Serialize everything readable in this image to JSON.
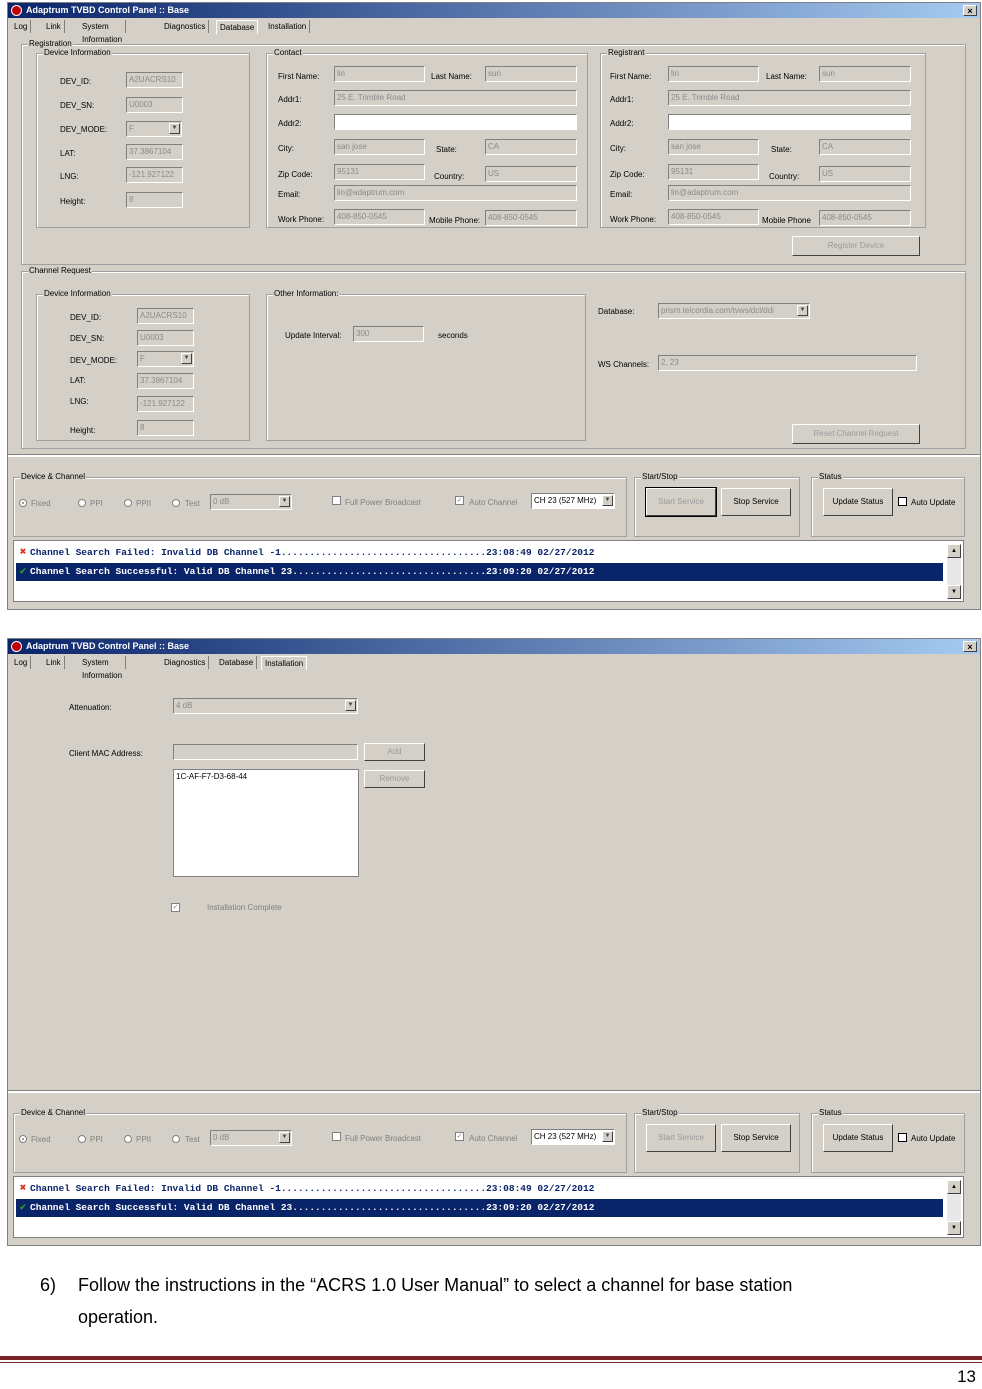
{
  "window1": {
    "title": "Adaptrum TVBD Control Panel :: Base",
    "close_glyph": "×",
    "tabs": [
      "Log",
      "Link",
      "System Information",
      "Diagnostics",
      "Database",
      "Installation"
    ],
    "active_tab": "Database",
    "registration": {
      "label": "Registration",
      "device_info": {
        "label": "Device Information",
        "dev_id_label": "DEV_ID:",
        "dev_id": "A2UACRS10",
        "dev_sn_label": "DEV_SN:",
        "dev_sn": "U0003",
        "dev_mode_label": "DEV_MODE:",
        "dev_mode": "F",
        "lat_label": "LAT:",
        "lat": "37.3867104",
        "lng_label": "LNG:",
        "lng": "-121.927122",
        "height_label": "Height:",
        "height": "8"
      },
      "contact": {
        "label": "Contact",
        "first_name_label": "First Name:",
        "first_name": "lin",
        "last_name_label": "Last Name:",
        "last_name": "sun",
        "addr1_label": "Addr1:",
        "addr1": "25 E. Trimble Road",
        "addr2_label": "Addr2:",
        "addr2": "",
        "city_label": "City:",
        "city": "san jose",
        "state_label": "State:",
        "state": "CA",
        "zip_label": "Zip Code:",
        "zip": "95131",
        "country_label": "Country:",
        "country": "US",
        "email_label": "Email:",
        "email": "lin@adaptrum.com",
        "work_phone_label": "Work Phone:",
        "work_phone": "408-850-0545",
        "mobile_phone_label": "Mobile Phone:",
        "mobile_phone": "408-850-0545"
      },
      "registrant": {
        "label": "Registrant",
        "first_name_label": "First Name:",
        "first_name": "lin",
        "last_name_label": "Last Name:",
        "last_name": "sun",
        "addr1_label": "Addr1:",
        "addr1": "25 E. Trimble Road",
        "addr2_label": "Addr2:",
        "addr2": "",
        "city_label": "City:",
        "city": "san jose",
        "state_label": "State:",
        "state": "CA",
        "zip_label": "Zip Code:",
        "zip": "95131",
        "country_label": "Country:",
        "country": "US",
        "email_label": "Email:",
        "email": "lin@adaptrum.com",
        "work_phone_label": "Work Phone:",
        "work_phone": "408-850-0545",
        "mobile_phone_label": "Mobile Phone",
        "mobile_phone": "408-850-0545"
      },
      "register_button": "Register Device"
    },
    "channel_request": {
      "label": "Channel Request",
      "device_info": {
        "label": "Device Information",
        "dev_id_label": "DEV_ID:",
        "dev_id": "A2UACRS10",
        "dev_sn_label": "DEV_SN:",
        "dev_sn": "U0003",
        "dev_mode_label": "DEV_MODE:",
        "dev_mode": "F",
        "lat_label": "LAT:",
        "lat": "37.3867104",
        "lng_label": "LNG:",
        "lng": "-121.927122",
        "height_label": "Height:",
        "height": "8"
      },
      "other_info": {
        "label": "Other Information:",
        "update_interval_label": "Update Interval:",
        "update_interval": "300",
        "seconds_label": "seconds"
      },
      "database_label": "Database:",
      "database": "prism.telcordia.com/tvws/dcl/ddi",
      "ws_channels_label": "WS Channels:",
      "ws_channels": "2, 23",
      "reset_button": "Reset Channel Request"
    }
  },
  "window2": {
    "title": "Adaptrum TVBD Control Panel :: Base",
    "close_glyph": "×",
    "tabs": [
      "Log",
      "Link",
      "System Information",
      "Diagnostics",
      "Database",
      "Installation"
    ],
    "active_tab": "Installation",
    "attenuation_label": "Attenuation:",
    "attenuation": "4 dB",
    "client_mac_label": "Client MAC Address:",
    "client_mac_value": "",
    "add_button": "Add",
    "remove_button": "Remove",
    "mac_list": [
      "1C-AF-F7-D3-68-44"
    ],
    "installation_complete_label": "Installation Complete",
    "installation_complete_checked": true
  },
  "bottom_panel": {
    "device_channel": {
      "label": "Device & Channel",
      "radios": [
        "Fixed",
        "PPI",
        "PPII",
        "Test"
      ],
      "selected_radio": "Fixed",
      "test_level": "0 dB",
      "full_power_label": "Full Power Broadcast",
      "full_power_checked": false,
      "auto_channel_label": "Auto Channel",
      "auto_channel_checked": true,
      "channel": "CH 23 (527 MHz)"
    },
    "start_stop": {
      "label": "Start/Stop",
      "start_button": "Start Service",
      "stop_button": "Stop Service"
    },
    "status": {
      "label": "Status",
      "update_button": "Update Status",
      "auto_update_label": "Auto Update",
      "auto_update_checked": false
    },
    "log": [
      {
        "status": "error",
        "text": "Channel Search Failed: Invalid DB Channel -1....................................23:08:49  02/27/2012"
      },
      {
        "status": "ok",
        "text": "Channel Search Successful: Valid DB Channel 23..................................23:09:20  02/27/2012",
        "selected": true
      }
    ]
  },
  "document": {
    "step_number": "6)",
    "step_text_line1": "Follow the instructions in the “ACRS 1.0 User Manual” to select a channel for base station",
    "step_text_line2": "operation.",
    "page_number": "13"
  },
  "colors": {
    "titlebar_start": "#0a246a",
    "titlebar_end": "#a6caf0",
    "window_bg": "#d4d0c8",
    "log_selected": "#0a246a",
    "rule": "#7b2226",
    "error_icon": "#e0301e",
    "ok_icon": "#2aa02a"
  },
  "icons": {
    "error": "x-mark-icon",
    "ok": "check-mark-icon",
    "app": "app-logo-icon"
  }
}
